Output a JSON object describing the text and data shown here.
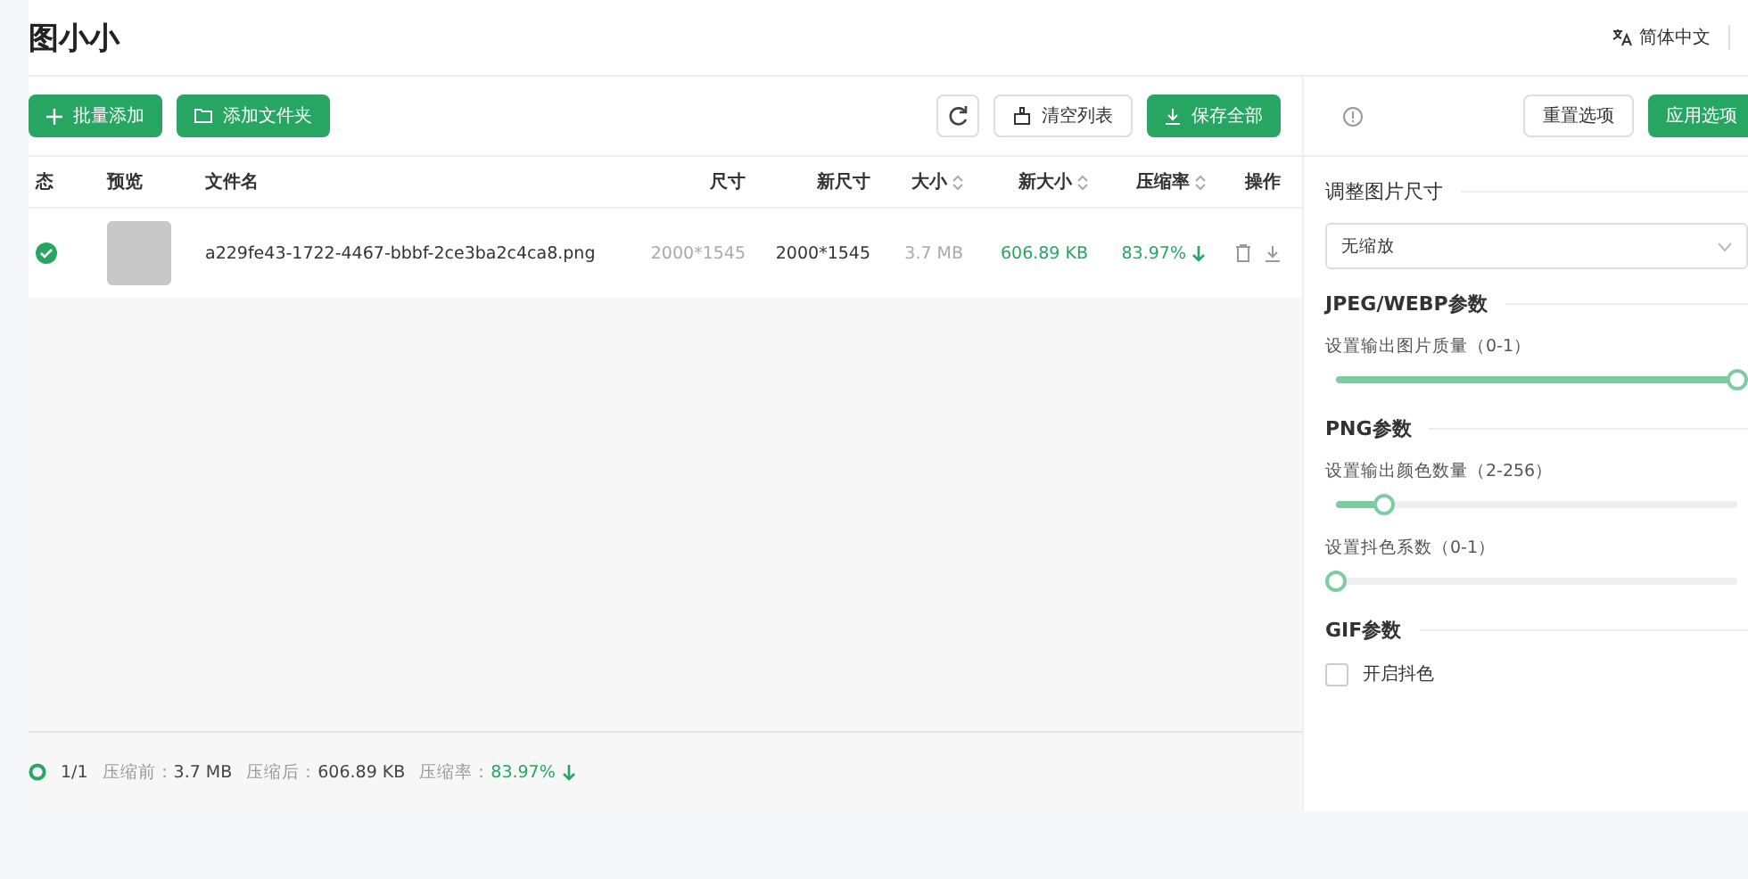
{
  "header": {
    "title": "图小小",
    "language": "简体中文"
  },
  "toolbar": {
    "left_buttons": [
      {
        "label": "批量添加"
      },
      {
        "label": "添加文件夹"
      }
    ],
    "clear": "清空列表",
    "save_all": "保存全部"
  },
  "table": {
    "columns": [
      {
        "label": "态",
        "sortable": false
      },
      {
        "label": "预览",
        "sortable": false
      },
      {
        "label": "文件名",
        "sortable": false
      },
      {
        "label": "尺寸",
        "sortable": false
      },
      {
        "label": "新尺寸",
        "sortable": false
      },
      {
        "label": "大小",
        "sortable": true
      },
      {
        "label": "新大小",
        "sortable": true
      },
      {
        "label": "压缩率",
        "sortable": true
      },
      {
        "label": "操作",
        "sortable": false
      }
    ],
    "rows": [
      {
        "done": true,
        "filename": "a229fe43-1722-4467-bbbf-2ce3ba2c4ca8.png",
        "size": "2000*1545",
        "new_size": "2000*1545",
        "bytes": "3.7 MB",
        "new_bytes": "606.89 KB",
        "rate": "83.97%"
      }
    ]
  },
  "footer": {
    "progress": "1/1",
    "items": [
      {
        "label": "压缩前：",
        "value": "3.7 MB",
        "accent": false
      },
      {
        "label": "压缩后：",
        "value": "606.89 KB",
        "accent": false
      },
      {
        "label": "压缩率：",
        "value": "83.97%",
        "accent": true
      }
    ]
  },
  "options": {
    "reset": "重置选项",
    "apply": "应用选项",
    "sections": [
      {
        "title": "调整图片尺寸",
        "controls": [
          {
            "kind": "select",
            "value": "无缩放"
          }
        ]
      },
      {
        "title": "JPEG/WEBP参数",
        "controls": [
          {
            "kind": "slider",
            "label": "设置输出图片质量（0-1）",
            "level": 1
          }
        ]
      },
      {
        "title": "PNG参数",
        "controls": [
          {
            "kind": "slider",
            "label": "设置输出颜色数量（2-256）",
            "level": 0.12
          },
          {
            "kind": "slider",
            "label": "设置抖色系数（0-1）",
            "level": 0
          }
        ]
      },
      {
        "title": "GIF参数",
        "controls": [
          {
            "kind": "checkbox",
            "label": "开启抖色",
            "checked": false
          }
        ]
      }
    ]
  }
}
